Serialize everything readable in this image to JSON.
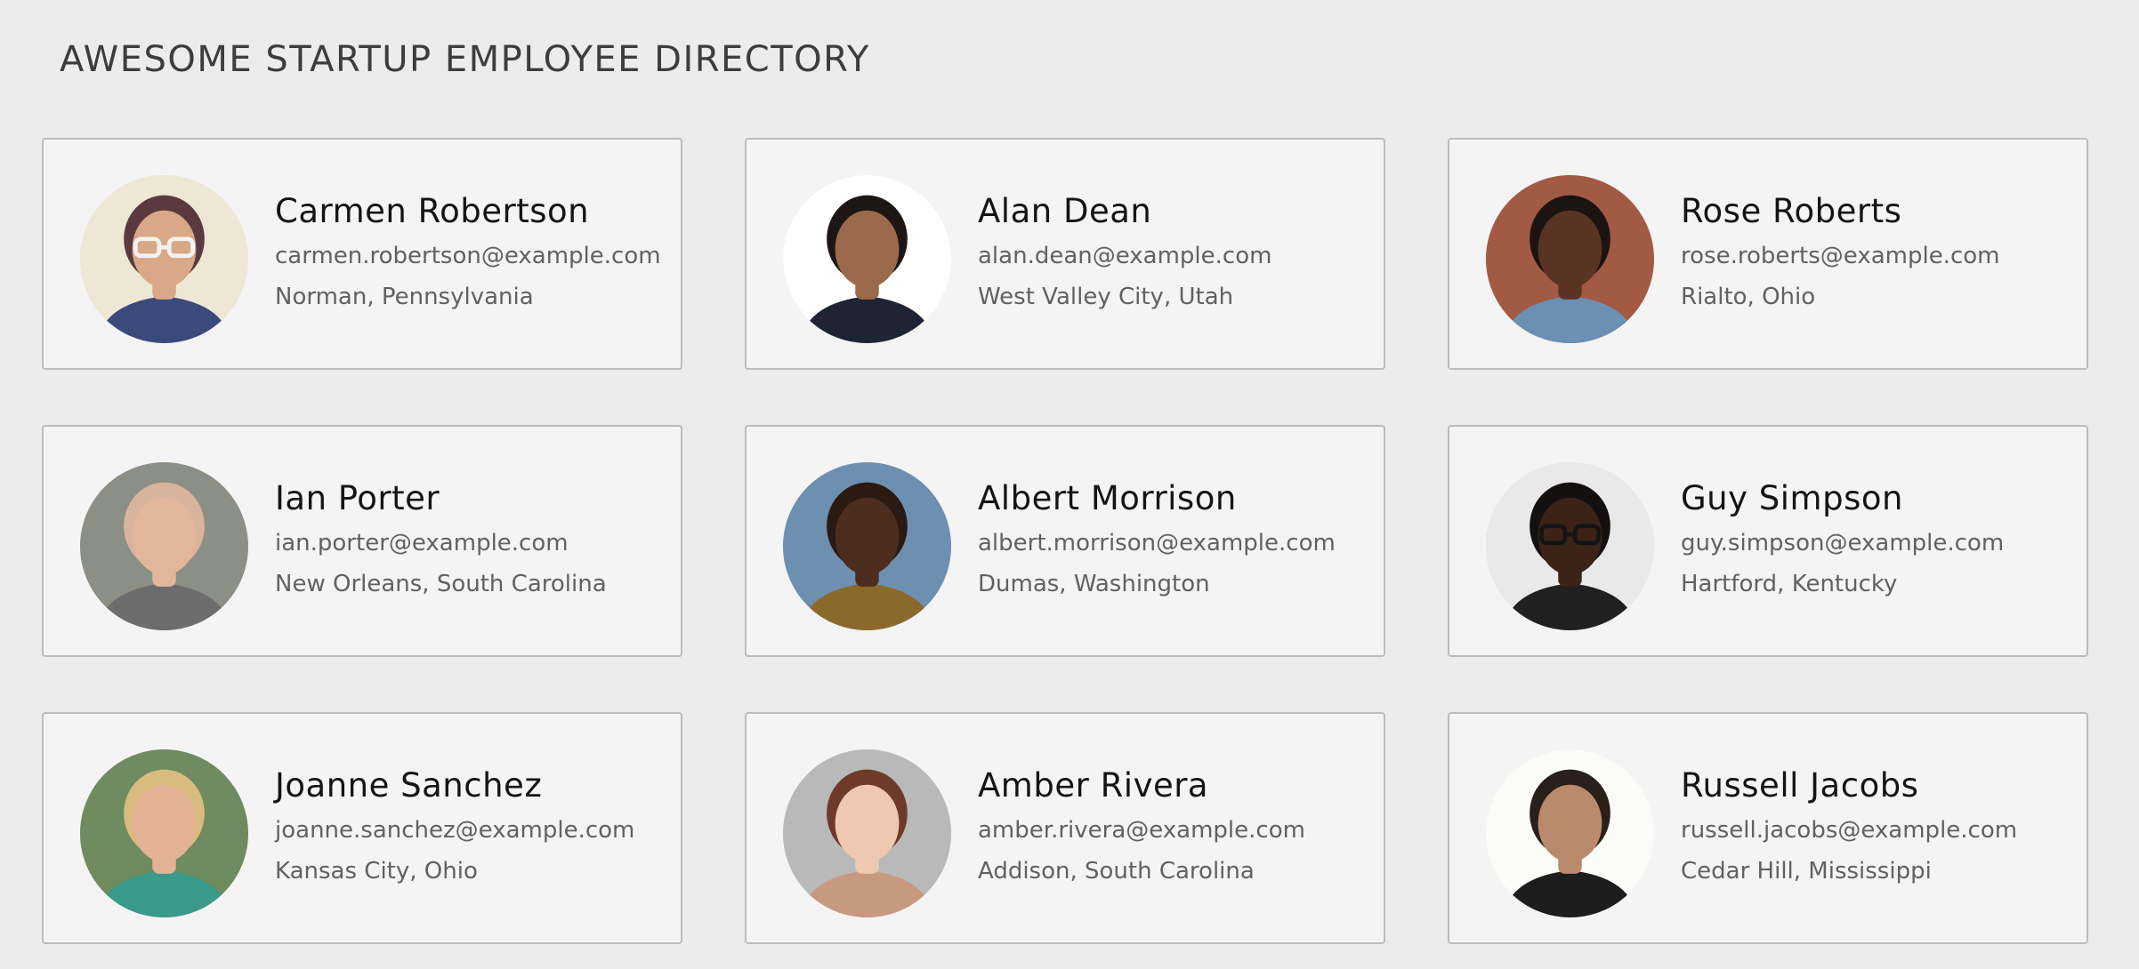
{
  "header": {
    "title": "AWESOME STARTUP EMPLOYEE DIRECTORY"
  },
  "employees": [
    {
      "name": "Carmen Robertson",
      "email": "carmen.robertson@example.com",
      "location": "Norman, Pennsylvania",
      "photo": {
        "bg": "#efe7d6",
        "skin": "#d8a887",
        "hair": "#5a3a40",
        "clothes": "#3a4a7a",
        "glasses": "#f2f2f2"
      }
    },
    {
      "name": "Alan Dean",
      "email": "alan.dean@example.com",
      "location": "West Valley City, Utah",
      "photo": {
        "bg": "#ffffff",
        "skin": "#9b6a4c",
        "hair": "#1e1614",
        "clothes": "#1f2433",
        "glasses": ""
      }
    },
    {
      "name": "Rose Roberts",
      "email": "rose.roberts@example.com",
      "location": "Rialto, Ohio",
      "photo": {
        "bg": "#a35a45",
        "skin": "#5a3423",
        "hair": "#1c1411",
        "clothes": "#6b8fb5",
        "glasses": ""
      }
    },
    {
      "name": "Ian Porter",
      "email": "ian.porter@example.com",
      "location": "New Orleans, South Carolina",
      "photo": {
        "bg": "#8c8f86",
        "skin": "#e2b69b",
        "hair": "#d9b49d",
        "clothes": "#6d6d6d",
        "glasses": ""
      }
    },
    {
      "name": "Albert Morrison",
      "email": "albert.morrison@example.com",
      "location": "Dumas, Washington",
      "photo": {
        "bg": "#6d8fb0",
        "skin": "#4c2d1e",
        "hair": "#2a1a12",
        "clothes": "#8a6a2a",
        "glasses": ""
      }
    },
    {
      "name": "Guy Simpson",
      "email": "guy.simpson@example.com",
      "location": "Hartford, Kentucky",
      "photo": {
        "bg": "#e9e9e9",
        "skin": "#3b2318",
        "hair": "#141010",
        "clothes": "#202020",
        "glasses": "#141414"
      }
    },
    {
      "name": "Joanne Sanchez",
      "email": "joanne.sanchez@example.com",
      "location": "Kansas City, Ohio",
      "photo": {
        "bg": "#6f8b5f",
        "skin": "#e3b294",
        "hair": "#d9bb7f",
        "clothes": "#3a9b8a",
        "glasses": ""
      }
    },
    {
      "name": "Amber Rivera",
      "email": "amber.rivera@example.com",
      "location": "Addison, South Carolina",
      "photo": {
        "bg": "#b9b9b9",
        "skin": "#efc8b2",
        "hair": "#6e3a2a",
        "clothes": "#c79a80",
        "glasses": ""
      }
    },
    {
      "name": "Russell Jacobs",
      "email": "russell.jacobs@example.com",
      "location": "Cedar Hill, Mississippi",
      "photo": {
        "bg": "#fbfbf8",
        "skin": "#b98a6c",
        "hair": "#2a1f1a",
        "clothes": "#1d1d1d",
        "glasses": ""
      }
    }
  ]
}
